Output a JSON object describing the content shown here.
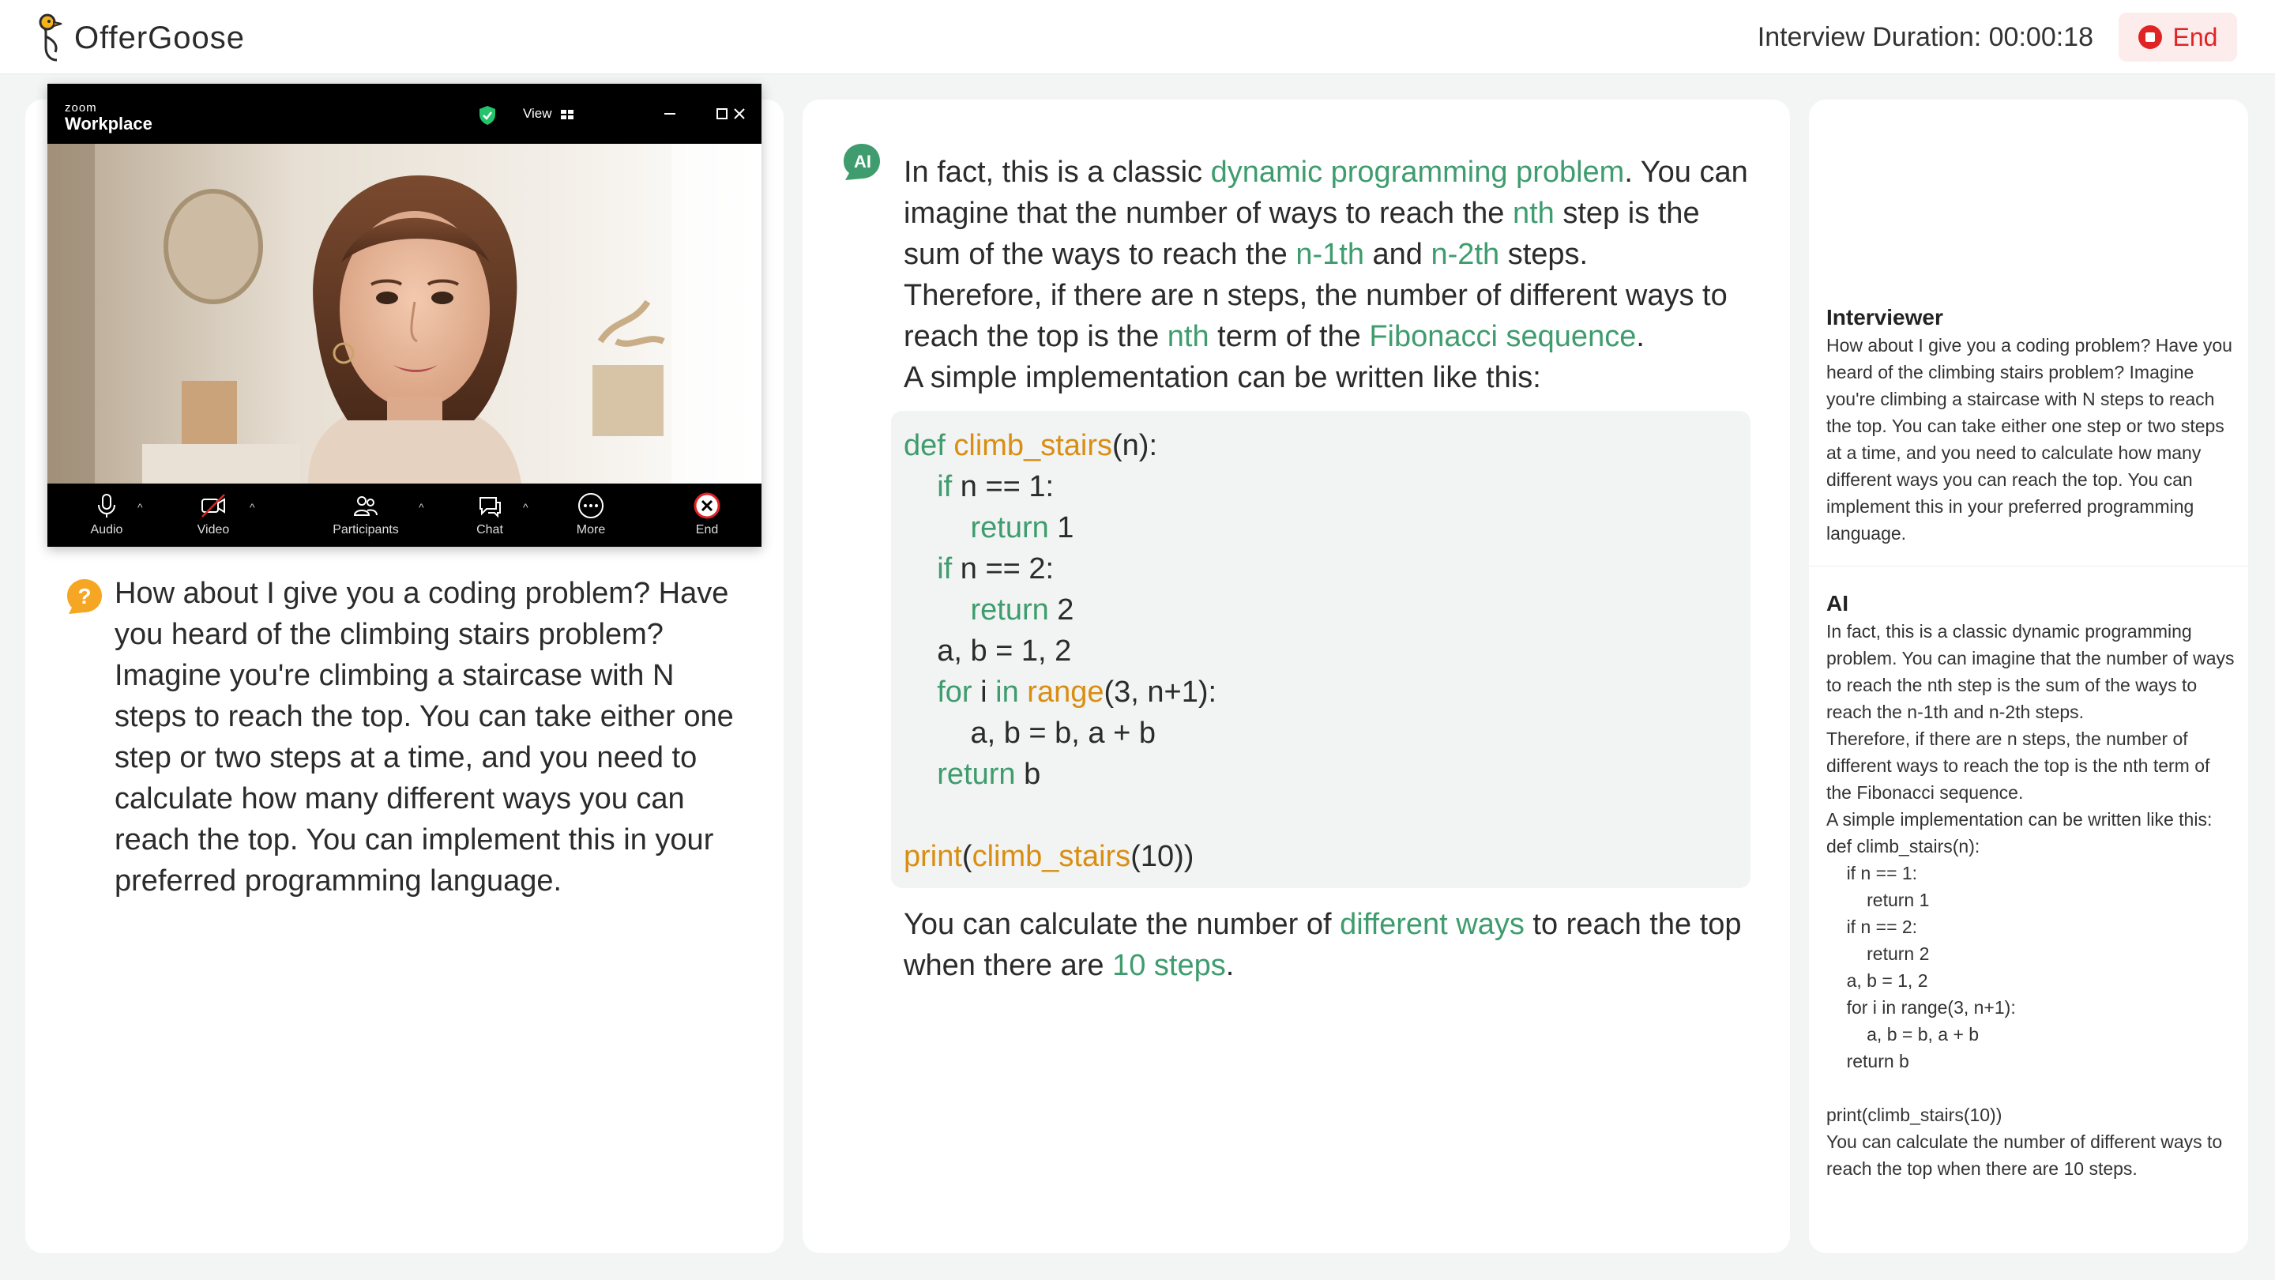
{
  "app": {
    "name": "OfferGoose",
    "duration_label": "Interview Duration: 00:00:18",
    "end_label": "End"
  },
  "zoom": {
    "brand_small": "zoom",
    "brand": "Workplace",
    "view_label": "View",
    "toolbar": {
      "audio": "Audio",
      "video": "Video",
      "participants": "Participants",
      "chat": "Chat",
      "more": "More",
      "end": "End"
    }
  },
  "question": {
    "text": "How about I give you a coding problem? Have you heard of the climbing stairs problem? Imagine you're climbing a staircase with N steps to reach the top. You can take either one step or two steps at a time, and you need to calculate how many different ways you can reach the top. You can implement this in your preferred programming language."
  },
  "answer": {
    "icon_label": "AI",
    "p1_a": "In fact, this is a classic ",
    "p1_hl1": "dynamic programming problem",
    "p1_b": ". You can imagine that the number of ways to reach the ",
    "p1_hl2": "nth",
    "p1_c": " step is the sum of the ways to reach the ",
    "p1_hl3": "n-1th",
    "p1_d": " and ",
    "p1_hl4": "n-2th",
    "p1_e": " steps.",
    "p2_a": "Therefore, if there are n steps, the number of different ways to reach the top is the ",
    "p2_hl1": "nth",
    "p2_b": " term of the ",
    "p2_hl2": "Fibonacci sequence",
    "p2_c": ".",
    "p3": "A simple implementation can be written like this:",
    "p4_a": "You can calculate the number of ",
    "p4_hl1": "different ways",
    "p4_b": " to reach the top when there are ",
    "p4_hl2": "10 steps",
    "p4_c": "."
  },
  "code": {
    "l1_kw": "def",
    "l1_fn": "climb_stairs",
    "l1_rest": "(n):",
    "l2_kw": "if",
    "l2_rest": " n == 1:",
    "l3_kw": "return",
    "l3_rest": " 1",
    "l4_kw": "if",
    "l4_rest": " n == 2:",
    "l5_kw": "return",
    "l5_rest": " 2",
    "l6": "a, b = 1, 2",
    "l7_kw1": "for",
    "l7_mid": " i ",
    "l7_kw2": "in",
    "l7_fn": "range",
    "l7_rest": "(3, n+1):",
    "l8": "a, b = b, a + b",
    "l9_kw": "return",
    "l9_rest": " b",
    "l10_fn1": "print",
    "l10_paren": "(",
    "l10_fn2": "climb_stairs",
    "l10_rest": "(10))"
  },
  "transcript": {
    "interviewer_name": "Interviewer",
    "interviewer_text": "How about I give you a coding problem? Have you heard of the climbing stairs problem? Imagine you're climbing a staircase with N steps to reach the top. You can take either one step or two steps at a time, and you need to calculate how many different ways you can reach the top. You can implement this in your preferred programming language.",
    "ai_name": "AI",
    "ai_text": "In fact, this is a classic dynamic programming problem. You can imagine that the number of ways to reach the nth step is the sum of the ways to reach the n-1th and n-2th steps.\nTherefore, if there are n steps, the number of different ways to reach the top is the nth term of the Fibonacci sequence.\nA simple implementation can be written like this:\ndef climb_stairs(n):\n    if n == 1:\n        return 1\n    if n == 2:\n        return 2\n    a, b = 1, 2\n    for i in range(3, n+1):\n        a, b = b, a + b\n    return b\n\nprint(climb_stairs(10))\nYou can calculate the number of different ways to reach the top when there are 10 steps."
  },
  "colors": {
    "highlight": "#3f9c6e",
    "function": "#d98e12",
    "end_red": "#e02424",
    "question_badge": "#f5a623"
  }
}
